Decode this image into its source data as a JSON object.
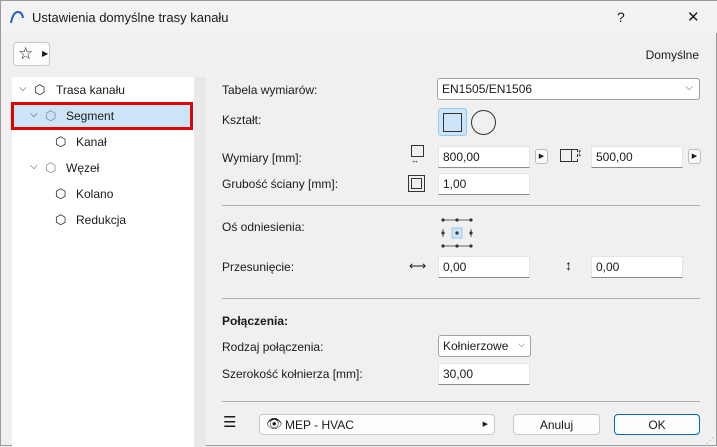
{
  "title": "Ustawienia domyślne trasy kanału",
  "help": "?",
  "close": "✕",
  "favorites_icon": "star-icon",
  "preset": "Domyślne",
  "tree": [
    {
      "label": "Trasa kanału"
    },
    {
      "label": "Segment"
    },
    {
      "label": "Kanał"
    },
    {
      "label": "Węzeł"
    },
    {
      "label": "Kolano"
    },
    {
      "label": "Redukcja"
    }
  ],
  "form": {
    "size_table_label": "Tabela wymiarów:",
    "size_table_value": "EN1505/EN1506",
    "shape_label": "Kształt:",
    "dimensions_label": "Wymiary [mm]:",
    "width_value": "800,00",
    "height_value": "500,00",
    "wall_label": "Grubość ściany [mm]:",
    "wall_value": "1,00",
    "ref_axis_label": "Oś odniesienia:",
    "offset_label": "Przesunięcie:",
    "offset_h": "0,00",
    "offset_v": "0,00",
    "connections_heading": "Połączenia:",
    "connection_type_label": "Rodzaj połączenia:",
    "connection_type_value": "Kołnierzowe",
    "flange_label": "Szerokość kołnierza [mm]:",
    "flange_value": "30,00"
  },
  "footer": {
    "layer": "MEP - HVAC",
    "cancel": "Anuluj",
    "ok": "OK"
  },
  "colors": {
    "selection": "#cce4f7",
    "highlight": "#e00000",
    "accent": "#0067c0"
  }
}
